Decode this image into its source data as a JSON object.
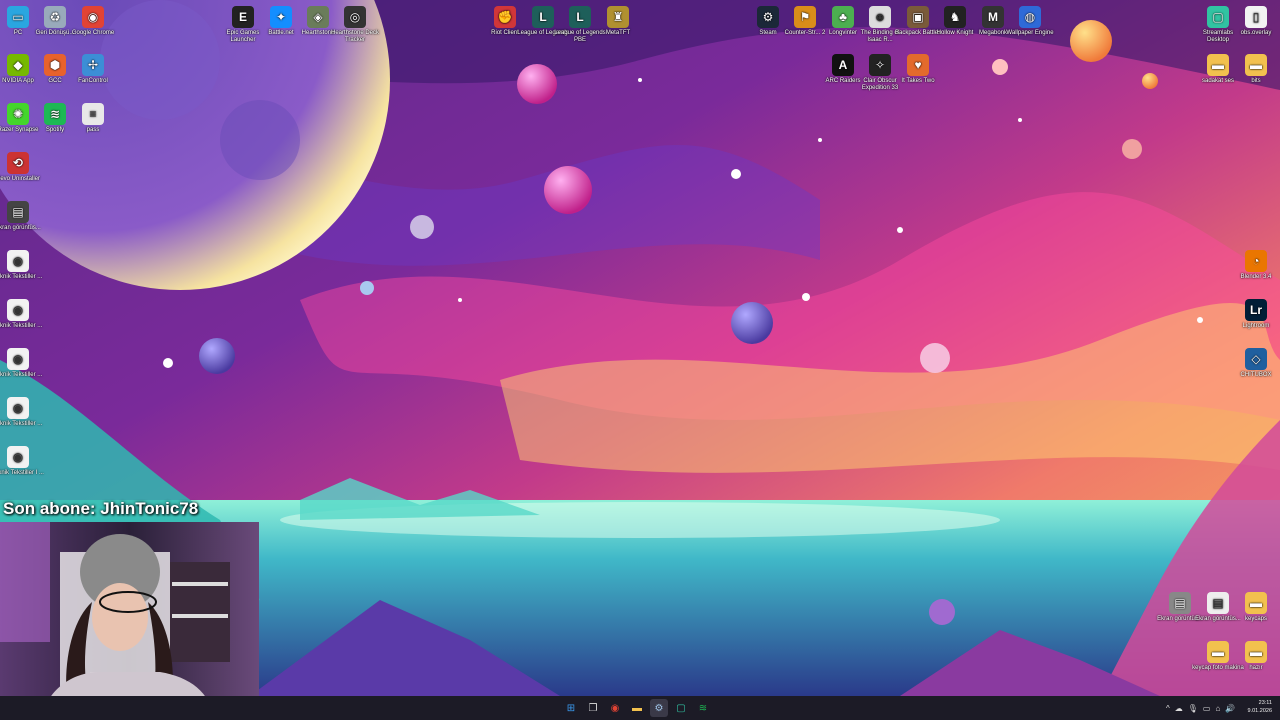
{
  "overlay": {
    "last_subscriber": "Son abone: JhinTonic78"
  },
  "desktop_left": [
    {
      "label": "PC",
      "icon": "pc-icon",
      "color": "#2aa6e0"
    },
    {
      "label": "Geri Dönüşü...",
      "icon": "recycle-bin-icon",
      "color": "#9ab"
    },
    {
      "label": "Google Chrome",
      "icon": "chrome-icon",
      "color": "#e24334"
    },
    {
      "label": "NVIDIA App",
      "icon": "nvidia-icon",
      "color": "#76b900"
    },
    {
      "label": "GCC",
      "icon": "gcc-icon",
      "color": "#e8622c"
    },
    {
      "label": "FanControl",
      "icon": "fancontrol-icon",
      "color": "#3c8ed6"
    },
    {
      "label": "Razer Synapse",
      "icon": "razer-icon",
      "color": "#44d62c"
    },
    {
      "label": "Spotify",
      "icon": "spotify-icon",
      "color": "#1db954"
    },
    {
      "label": "pass",
      "icon": "text-file-icon",
      "color": "#e8e8e8"
    },
    {
      "label": "Revo Uninstaller",
      "icon": "revo-icon",
      "color": "#c33"
    },
    {
      "label": "Ekran görüntüs...",
      "icon": "screenshot-icon",
      "color": "#444"
    },
    {
      "label": "Teknik Tekstiller ...",
      "icon": "chrome-doc-icon",
      "color": "#f2f2f2"
    },
    {
      "label": "Teknik Tekstiller ...",
      "icon": "chrome-doc-icon",
      "color": "#f2f2f2"
    },
    {
      "label": "Teknik Tekstiller ...",
      "icon": "chrome-doc-icon",
      "color": "#f2f2f2"
    },
    {
      "label": "Teknik Tekstiller ...",
      "icon": "chrome-doc-icon",
      "color": "#f2f2f2"
    },
    {
      "label": "Teknik Tekstiller I ...",
      "icon": "chrome-doc-icon",
      "color": "#f2f2f2"
    }
  ],
  "desktop_top": [
    {
      "label": "Epic Games Launcher",
      "icon": "epic-icon",
      "color": "#222"
    },
    {
      "label": "Battle.net",
      "icon": "battlenet-icon",
      "color": "#148eff"
    },
    {
      "label": "Hearthstone",
      "icon": "hearthstone-icon",
      "color": "#6a7c5a"
    },
    {
      "label": "Hearthstone Deck Tracker",
      "icon": "deck-tracker-icon",
      "color": "#333"
    },
    {
      "label": "Riot Client",
      "icon": "riot-icon",
      "color": "#d13639"
    },
    {
      "label": "League of Legends",
      "icon": "lol-icon",
      "color": "#1e5f5a"
    },
    {
      "label": "League of Legends PBE",
      "icon": "lol-pbe-icon",
      "color": "#1e5f5a"
    },
    {
      "label": "MetaTFT",
      "icon": "metatft-icon",
      "color": "#b09030"
    },
    {
      "label": "Steam",
      "icon": "steam-icon",
      "color": "#1b2838"
    },
    {
      "label": "Counter-Str... 2",
      "icon": "cs2-icon",
      "color": "#d98d1a"
    },
    {
      "label": "Longvinter",
      "icon": "longvinter-icon",
      "color": "#4caf50"
    },
    {
      "label": "The Binding of Isaac R...",
      "icon": "isaac-icon",
      "color": "#ddd"
    },
    {
      "label": "Backpack Battles",
      "icon": "backpack-icon",
      "color": "#7a5a3a"
    },
    {
      "label": "Hollow Knight",
      "icon": "hollow-knight-icon",
      "color": "#222"
    },
    {
      "label": "Megabonk",
      "icon": "megabonk-icon",
      "color": "#333"
    },
    {
      "label": "Wallpaper Engine",
      "icon": "wallpaper-engine-icon",
      "color": "#2e6ad8"
    },
    {
      "label": "ARC Raiders",
      "icon": "arc-raiders-icon",
      "color": "#111"
    },
    {
      "label": "Clair Obscur Expedition 33",
      "icon": "clair-obscur-icon",
      "color": "#222"
    },
    {
      "label": "It Takes Two",
      "icon": "it-takes-two-icon",
      "color": "#e36a2c"
    }
  ],
  "desktop_right": [
    {
      "label": "Streamlabs Desktop",
      "icon": "streamlabs-icon",
      "color": "#31c3a2"
    },
    {
      "label": "obs.overlay",
      "icon": "file-icon",
      "color": "#f2f2f2"
    },
    {
      "label": "sadakat ses",
      "icon": "folder-icon",
      "color": "#f2c14e"
    },
    {
      "label": "bits",
      "icon": "folder-icon",
      "color": "#f2c14e"
    },
    {
      "label": "Blender 3.4",
      "icon": "blender-icon",
      "color": "#ea7600"
    },
    {
      "label": "Lightroom",
      "icon": "lightroom-icon",
      "color": "#001e36"
    },
    {
      "label": "CHITUBOX",
      "icon": "chitubox-icon",
      "color": "#1f5f9f"
    },
    {
      "label": "Ekran görüntüs...",
      "icon": "screenshot-icon",
      "color": "#888"
    },
    {
      "label": "Ekran görüntüs...",
      "icon": "screenshot-icon",
      "color": "#eee"
    },
    {
      "label": "keycaps",
      "icon": "folder-icon",
      "color": "#f2c14e"
    },
    {
      "label": "keycap foto makina",
      "icon": "folder-icon",
      "color": "#f2c14e"
    },
    {
      "label": "hazır",
      "icon": "folder-icon",
      "color": "#f2c14e"
    }
  ],
  "taskbar": {
    "apps": [
      {
        "icon": "windows-start-icon",
        "color": "#3a9af0"
      },
      {
        "icon": "task-view-icon",
        "color": "#ddd"
      },
      {
        "icon": "chrome-icon",
        "color": "#e24334"
      },
      {
        "icon": "file-explorer-icon",
        "color": "#f2c14e"
      },
      {
        "icon": "steam-icon",
        "color": "#9fc3e6"
      },
      {
        "icon": "streamlabs-icon",
        "color": "#31c3a2"
      },
      {
        "icon": "spotify-icon",
        "color": "#1db954"
      }
    ],
    "time": "23:11",
    "date": "9.01.2026"
  }
}
